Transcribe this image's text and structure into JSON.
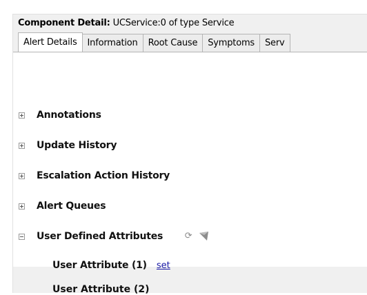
{
  "header": {
    "label": "Component Detail:",
    "value": "UCService:0 of type Service"
  },
  "tabs": [
    {
      "label": "Alert Details",
      "active": true
    },
    {
      "label": "Information",
      "active": false
    },
    {
      "label": "Root Cause",
      "active": false
    },
    {
      "label": "Symptoms",
      "active": false
    },
    {
      "label": "Serv",
      "active": false
    }
  ],
  "sections": [
    {
      "label": "Annotations",
      "expanded": false
    },
    {
      "label": "Update History",
      "expanded": false
    },
    {
      "label": "Escalation Action History",
      "expanded": false
    },
    {
      "label": "Alert Queues",
      "expanded": false
    },
    {
      "label": "User Defined Attributes",
      "expanded": true
    }
  ],
  "icons": {
    "refresh": "refresh-icon",
    "flag": "flag-icon"
  },
  "user_attributes": [
    {
      "label": "User Attribute (1)",
      "action": "set"
    },
    {
      "label": "User Attribute (2)"
    }
  ],
  "colors": {
    "panel_bg": "#f0f0f0",
    "link": "#1a1aa6",
    "tab_border": "#b4b4b4"
  }
}
